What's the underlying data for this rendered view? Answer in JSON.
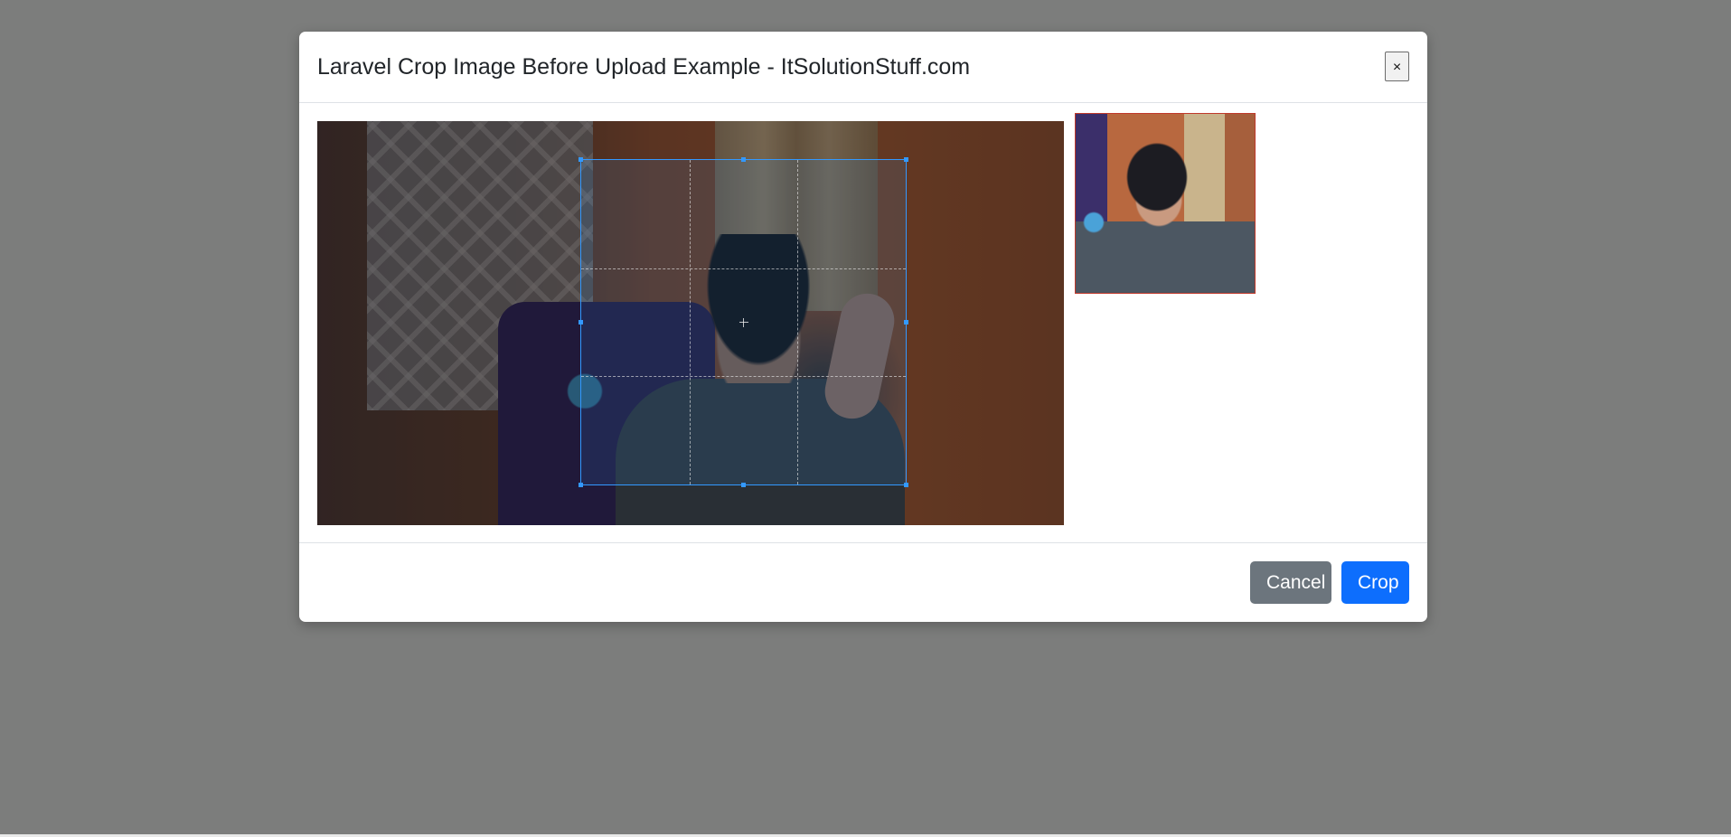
{
  "modal": {
    "title": "Laravel Crop Image Before Upload Example - ItSolutionStuff.com",
    "close_label": "×"
  },
  "footer": {
    "cancel_label": "Cancel",
    "crop_label": "Crop"
  },
  "colors": {
    "backdrop": "#7c7d7c",
    "crop_outline": "#3399ff",
    "cancel_button": "#6c757d",
    "crop_button": "#0d6efd",
    "preview_border": "#c0392b"
  }
}
